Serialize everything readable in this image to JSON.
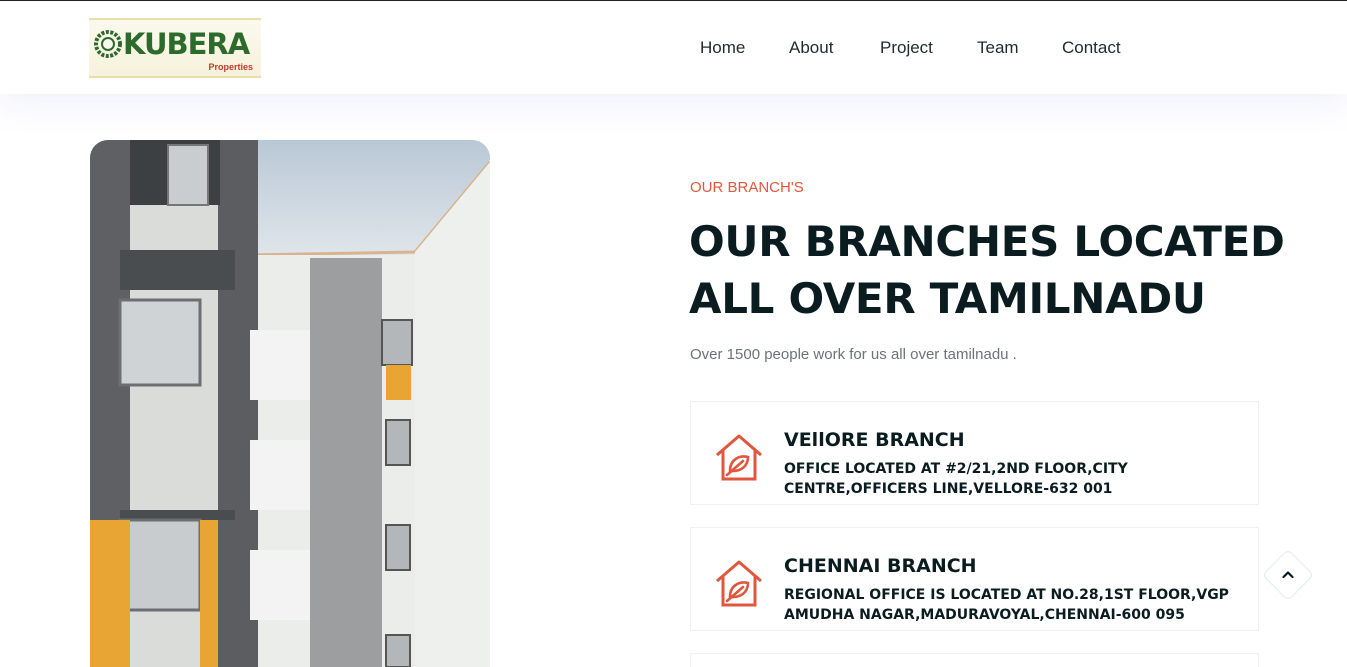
{
  "brand": {
    "name": "KUBERA",
    "word": "KUBERA",
    "tagline": "Properties",
    "colors": {
      "green": "#2d6b2d",
      "red": "#c23a2a",
      "gold": "#e7dfa6"
    }
  },
  "nav": {
    "items": [
      {
        "label": "Home"
      },
      {
        "label": "About"
      },
      {
        "label": "Project"
      },
      {
        "label": "Team"
      },
      {
        "label": "Contact"
      }
    ]
  },
  "section": {
    "eyebrow": "OUR BRANCH'S",
    "headline_line1": "OUR BRANCHES LOCATED",
    "headline_line2": "ALL OVER TAMILNADU",
    "lead": "Over 1500 people work for us all over tamilnadu ."
  },
  "branches": [
    {
      "title": "VEllORE BRANCH",
      "address": "OFFICE LOCATED AT #2/21,2ND FLOOR,CITY CENTRE,OFFICERS LINE,VELLORE-632 001",
      "icon": "house-leaf-icon"
    },
    {
      "title": "CHENNAI BRANCH",
      "address": "REGIONAL OFFICE IS LOCATED AT NO.28,1ST FLOOR,VGP AMUDHA NAGAR,MADURAVOYAL,CHENNAI-600 095",
      "icon": "house-leaf-icon"
    }
  ],
  "theme": {
    "accent": "#e0573d",
    "heading": "#0b1c21",
    "muted": "#6b7377"
  },
  "scroll_top": {
    "icon": "chevron-up-icon"
  }
}
